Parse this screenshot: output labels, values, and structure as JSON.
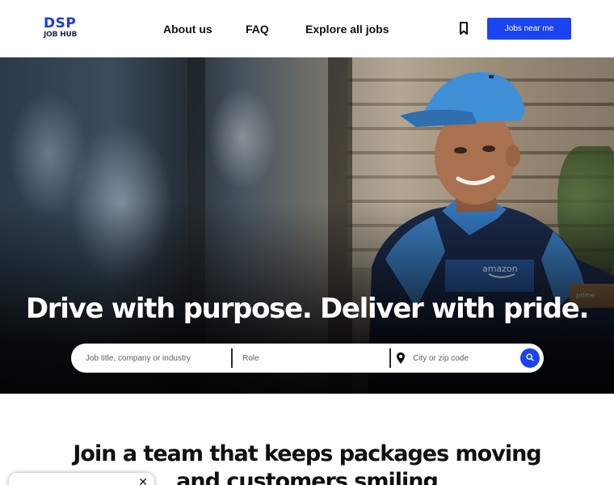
{
  "header": {
    "logo": {
      "line1": "DSP",
      "line2": "JOB HUB"
    },
    "nav": [
      {
        "label": "About us"
      },
      {
        "label": "FAQ"
      },
      {
        "label": "Explore all jobs"
      }
    ],
    "bookmark_icon": "bookmark-icon",
    "cta_label": "Jobs near me"
  },
  "hero": {
    "title": "Drive with purpose. Deliver with pride.",
    "search": {
      "job_placeholder": "Job title, company or industry",
      "role_placeholder": "Role",
      "location_placeholder": "City or zip code",
      "location_icon": "location-pin-icon",
      "search_icon": "search-icon"
    },
    "photo_text": {
      "uniform_brand": "amazon",
      "package_label": "prime"
    }
  },
  "section": {
    "title_line1": "Join a team that keeps packages moving",
    "title_line2": "and customers smiling"
  },
  "toast": {
    "close_icon": "close-icon"
  },
  "colors": {
    "accent": "#1A44F0",
    "text": "#0F1111",
    "background": "#FFFFFF"
  }
}
